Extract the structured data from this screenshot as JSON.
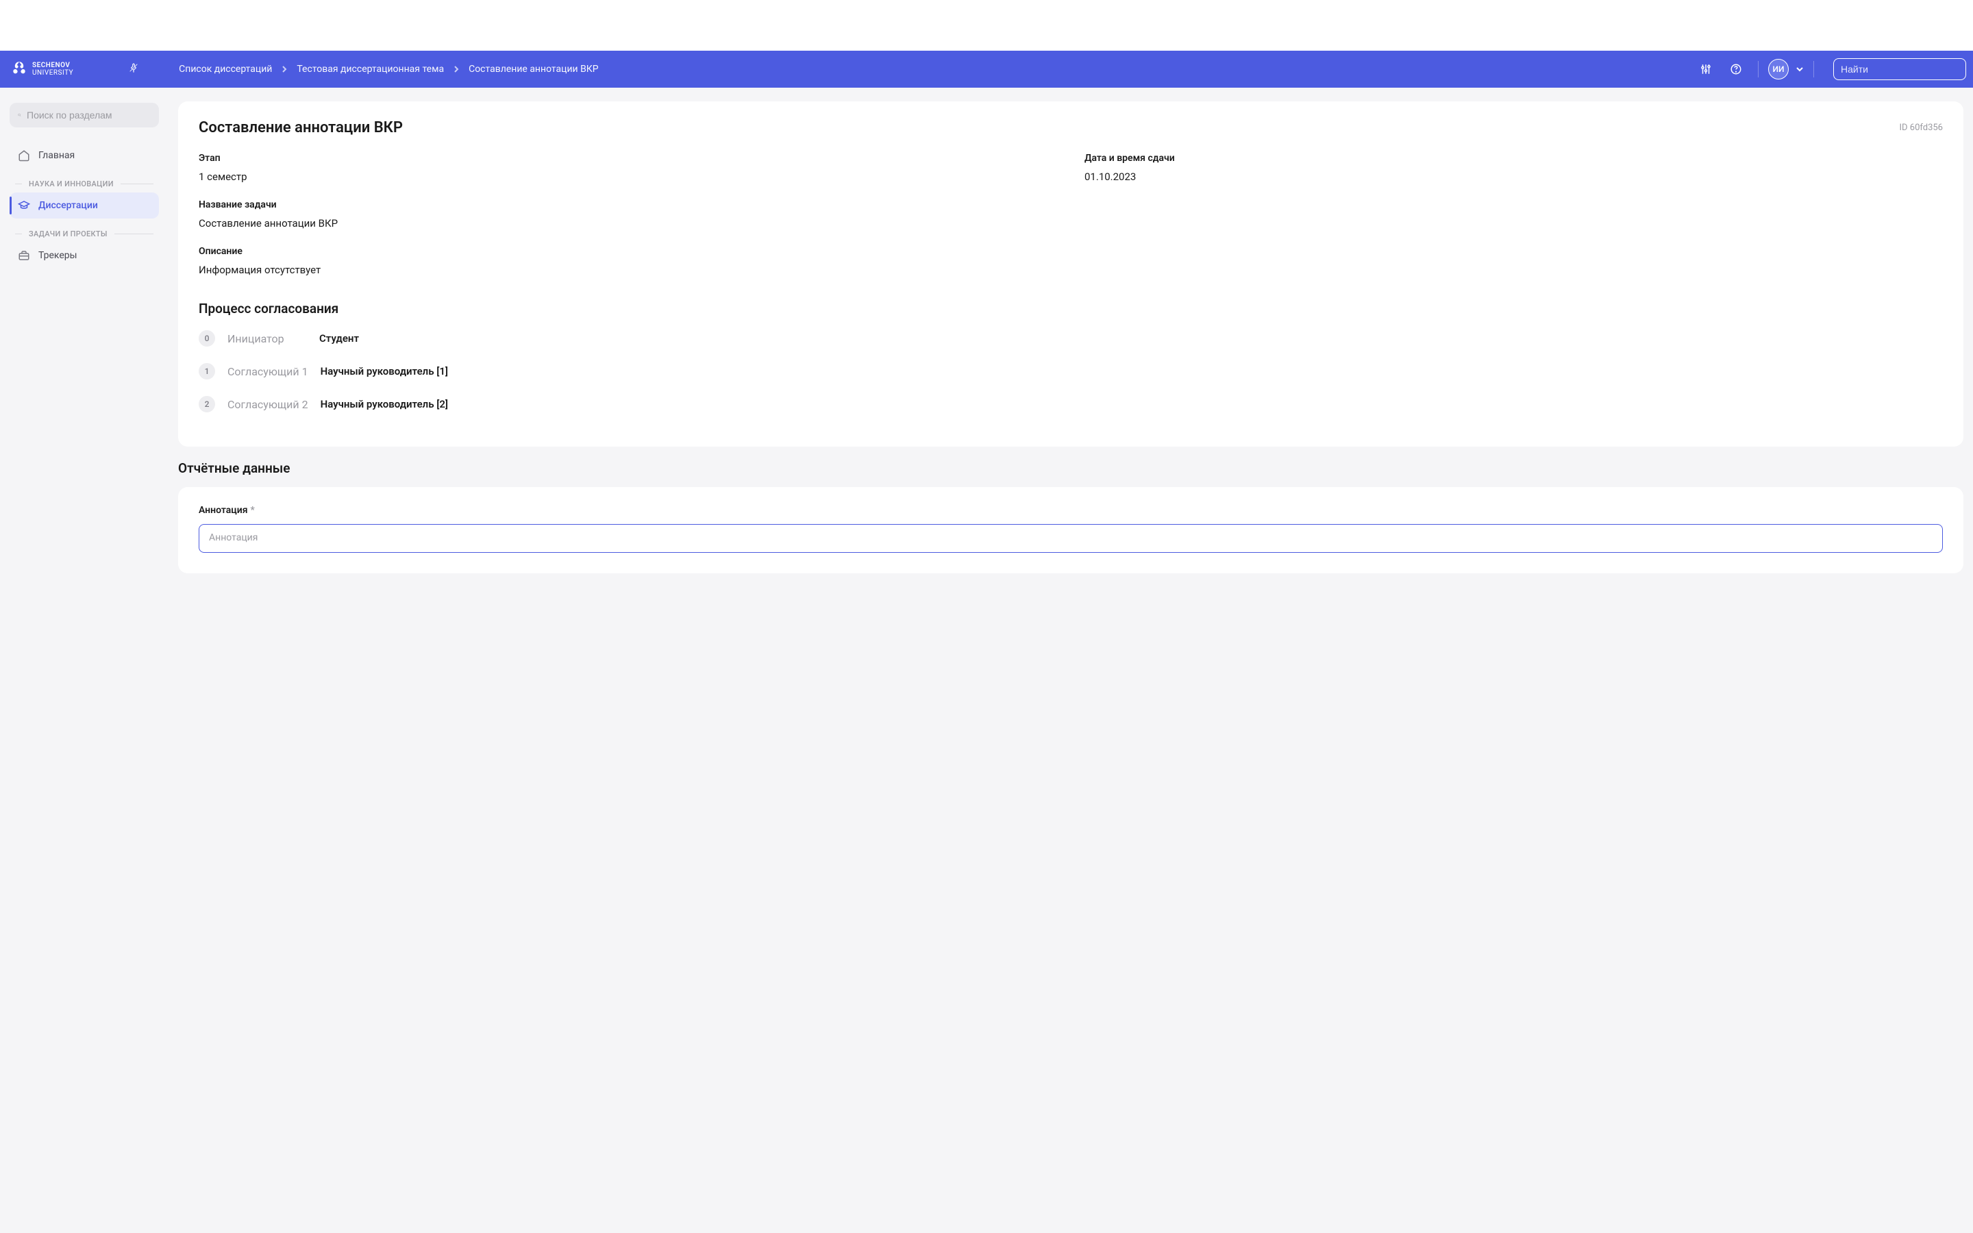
{
  "header": {
    "logo": {
      "line1": "SECHENOV",
      "line2": "UNIVERSITY"
    },
    "breadcrumbs": [
      "Список диссертаций",
      "Тестовая диссертационная тема",
      "Составление аннотации ВКР"
    ],
    "avatar_initials": "ИИ",
    "search_placeholder": "Найти"
  },
  "sidebar": {
    "search_placeholder": "Поиск по разделам",
    "home_label": "Главная",
    "section1": "НАУКА И ИННОВАЦИИ",
    "dissertations_label": "Диссертации",
    "section2": "ЗАДАЧИ И ПРОЕКТЫ",
    "trackers_label": "Трекеры"
  },
  "main": {
    "title": "Составление аннотации ВКР",
    "id_label": "ID 60fd356",
    "fields": {
      "stage_label": "Этап",
      "stage_value": "1 семестр",
      "deadline_label": "Дата и время сдачи",
      "deadline_value": "01.10.2023",
      "task_name_label": "Название задачи",
      "task_name_value": "Составление аннотации ВКР",
      "description_label": "Описание",
      "description_value": "Информация отсутствует"
    },
    "approval": {
      "title": "Процесс согласования",
      "rows": [
        {
          "num": "0",
          "role": "Инициатор",
          "person": "Студент"
        },
        {
          "num": "1",
          "role": "Согласующий 1",
          "person": "Научный руководитель [1]"
        },
        {
          "num": "2",
          "role": "Согласующий 2",
          "person": "Научный руководитель [2]"
        }
      ]
    },
    "report": {
      "title": "Отчётные данные",
      "annotation_label": "Аннотация",
      "annotation_placeholder": "Аннотация"
    }
  }
}
